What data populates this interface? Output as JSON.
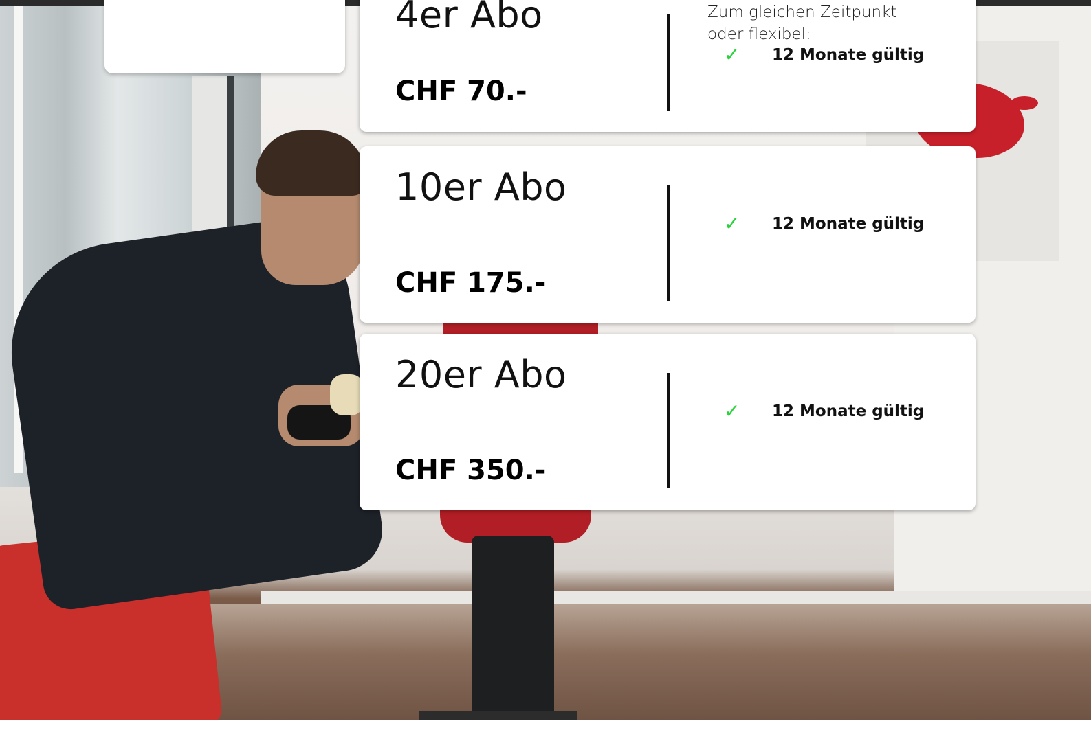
{
  "plans": [
    {
      "title": "4er Abo",
      "price": "CHF 70.-",
      "note": "Zum gleichen Zeitpunkt oder flexibel:",
      "features": [
        {
          "check": "✓",
          "text": "12 Monate gültig"
        }
      ]
    },
    {
      "title": "10er Abo",
      "price": "CHF 175.-",
      "note": "",
      "features": [
        {
          "check": "✓",
          "text": "12 Monate gültig"
        }
      ]
    },
    {
      "title": "20er Abo",
      "price": "CHF 350.-",
      "note": "",
      "features": [
        {
          "check": "✓",
          "text": "12 Monate gültig"
        }
      ]
    }
  ],
  "colors": {
    "check": "#29d43a",
    "card_background": "#ffffff",
    "accent_red": "#c8202a"
  },
  "icons": {
    "feature": "checkmark-icon"
  }
}
